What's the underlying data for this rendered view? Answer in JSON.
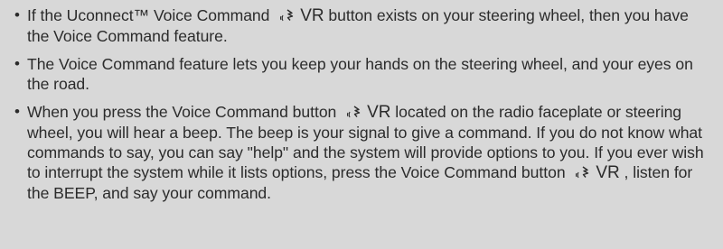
{
  "bullets": [
    {
      "p1": "If the Uconnect™ Voice Command ",
      "vr_label": "VR",
      "p2": " button exists on your steering wheel, then you have the Voice Command feature."
    },
    {
      "text": "The Voice Command feature lets you keep your hands on the steering wheel, and your eyes on the road."
    },
    {
      "p1": "When you press the Voice Command button ",
      "vr_label": "VR",
      "p2": " located on the radio faceplate or steering wheel, you will hear a beep. The beep is your signal to give a command. If you do not know what commands to say, you can say \"help\" and the system will provide options to you. If you ever wish to interrupt the system while it lists options, press the Voice Command button ",
      "vr_label_2": "VR",
      "p3": ", listen for the BEEP, and say your command."
    }
  ],
  "icons": {
    "voice_command": "voice-command-icon"
  },
  "colors": {
    "background": "#d8d8d8",
    "text": "#2b2b2b"
  }
}
